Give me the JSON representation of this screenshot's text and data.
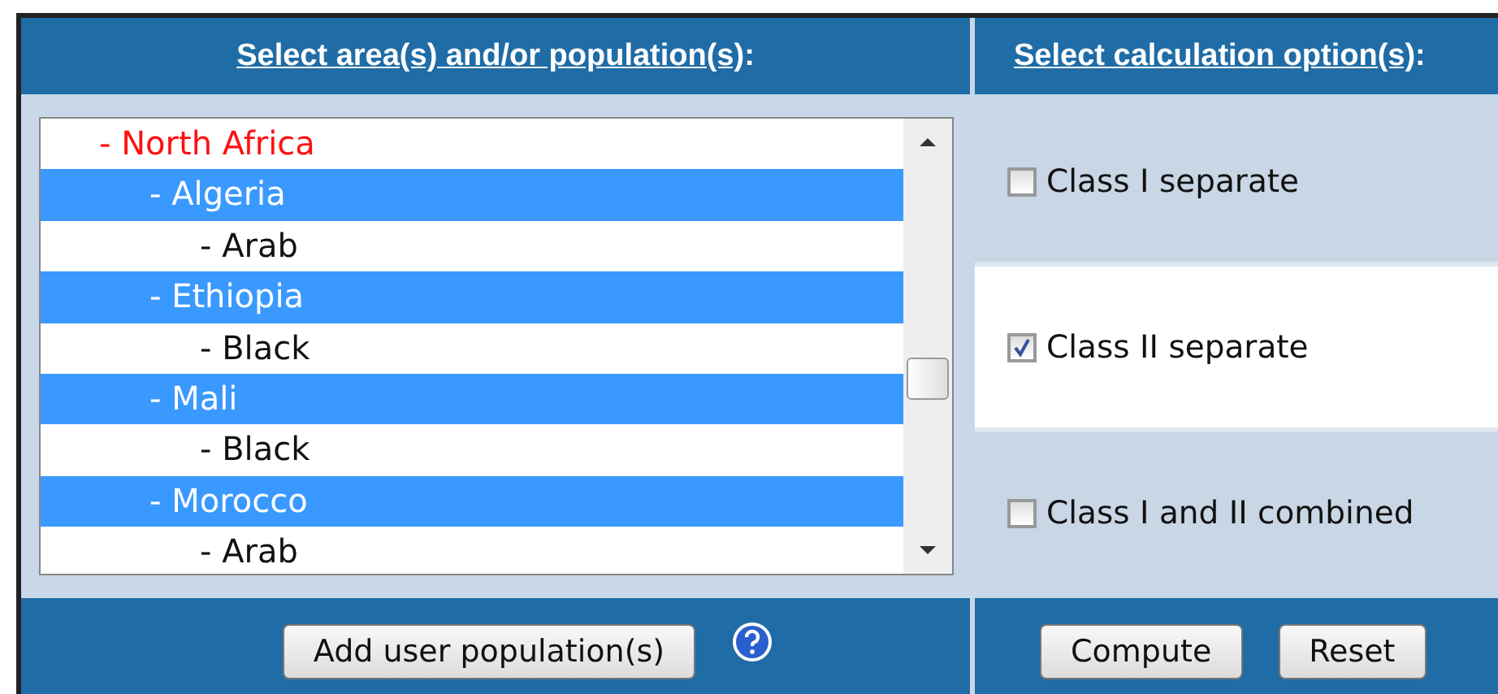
{
  "headers": [
    {
      "link": "Select area(s) and/or population(s)",
      "suffix": ":"
    },
    {
      "link": "Select calculation option(s)",
      "suffix": ":"
    }
  ],
  "tree": [
    {
      "label": "- North Africa",
      "selected": false,
      "children": [
        {
          "label": "- Algeria",
          "selected": true,
          "children": [
            {
              "label": "- Arab",
              "selected": false
            }
          ]
        },
        {
          "label": "- Ethiopia",
          "selected": true,
          "children": [
            {
              "label": "- Black",
              "selected": false
            }
          ]
        },
        {
          "label": "- Mali",
          "selected": true,
          "children": [
            {
              "label": "- Black",
              "selected": false
            }
          ]
        },
        {
          "label": "- Morocco",
          "selected": true,
          "children": [
            {
              "label": "- Arab",
              "selected": false
            }
          ]
        }
      ]
    }
  ],
  "options": [
    {
      "label": "Class I separate",
      "checked": false
    },
    {
      "label": "Class II separate",
      "checked": true
    },
    {
      "label": "Class I and II combined",
      "checked": false
    }
  ],
  "left_buttons": [
    "Add user population(s)"
  ],
  "right_buttons": [
    "Compute",
    "Reset"
  ]
}
